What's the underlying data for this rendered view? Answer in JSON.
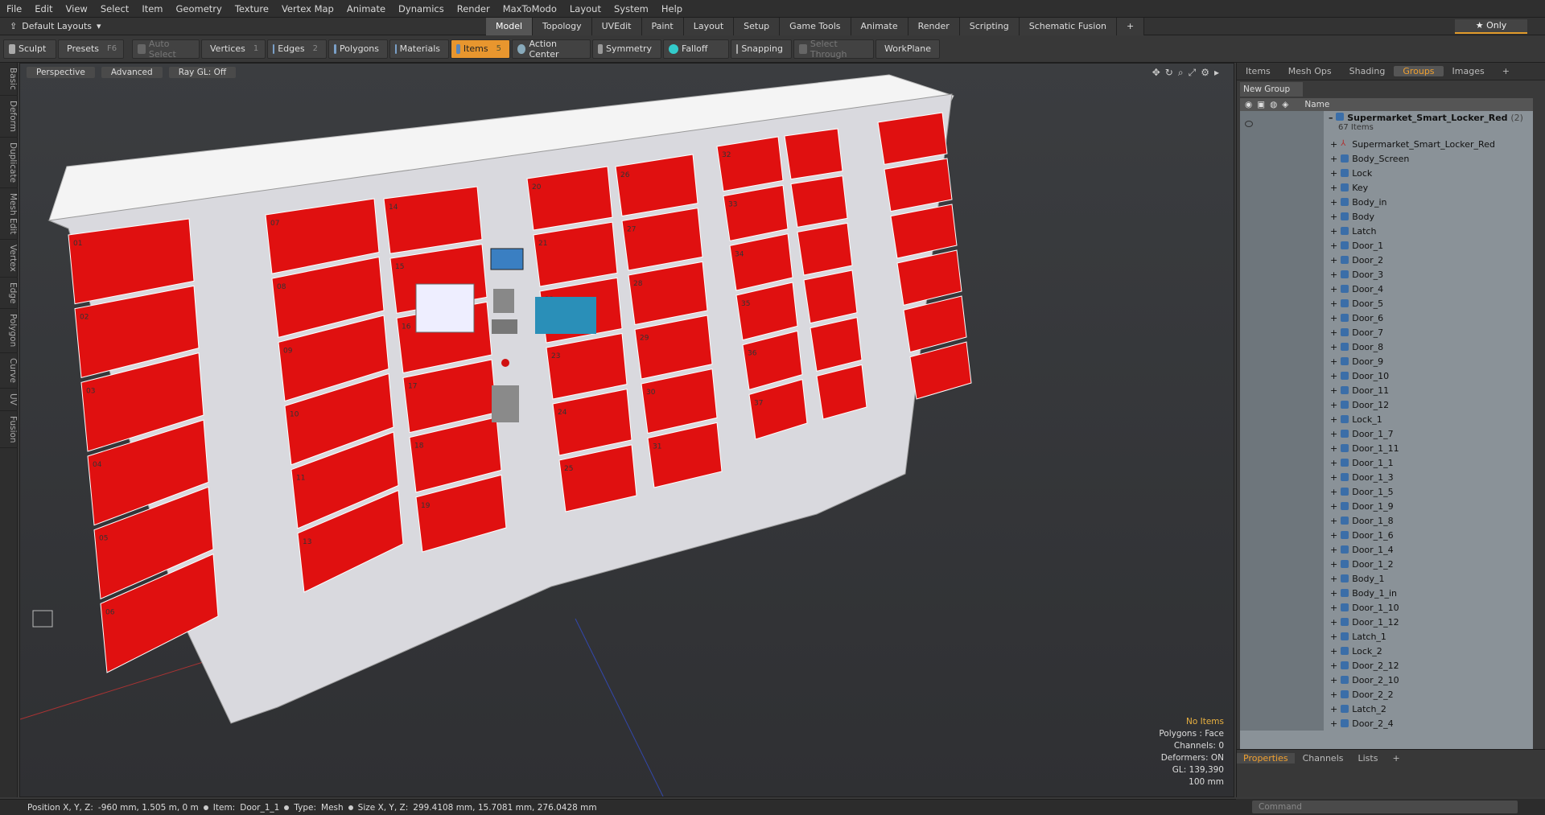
{
  "menu": [
    "File",
    "Edit",
    "View",
    "Select",
    "Item",
    "Geometry",
    "Texture",
    "Vertex Map",
    "Animate",
    "Dynamics",
    "Render",
    "MaxToModo",
    "Layout",
    "System",
    "Help"
  ],
  "layout_selector": "Default Layouts",
  "layout_tabs": [
    {
      "label": "Model",
      "active": true
    },
    {
      "label": "Topology"
    },
    {
      "label": "UVEdit"
    },
    {
      "label": "Paint"
    },
    {
      "label": "Layout"
    },
    {
      "label": "Setup"
    },
    {
      "label": "Game Tools"
    },
    {
      "label": "Animate"
    },
    {
      "label": "Render"
    },
    {
      "label": "Scripting"
    },
    {
      "label": "Schematic Fusion"
    },
    {
      "label": "+"
    }
  ],
  "only_label": "Only",
  "toolbar": {
    "sculpt": "Sculpt",
    "presets": "Presets",
    "presets_key": "F6",
    "auto_select": "Auto Select",
    "vertices": "Vertices",
    "vertices_key": "1",
    "edges": "Edges",
    "edges_key": "2",
    "polygons": "Polygons",
    "materials": "Materials",
    "items": "Items",
    "items_key": "5",
    "action_center": "Action Center",
    "symmetry": "Symmetry",
    "falloff": "Falloff",
    "snapping": "Snapping",
    "select_through": "Select Through",
    "workplane": "WorkPlane"
  },
  "left_tabs": [
    "Basic",
    "Deform",
    "Duplicate",
    "Mesh Edit",
    "Vertex",
    "Edge",
    "Polygon",
    "Curve",
    "UV",
    "Fusion"
  ],
  "viewport": {
    "view": "Perspective",
    "shading": "Advanced",
    "raygl": "Ray GL: Off",
    "stats": {
      "selection": "No Items",
      "polygons": "Polygons : Face",
      "channels": "Channels: 0",
      "deformers": "Deformers: ON",
      "gl": "GL: 139,390",
      "scale": "100 mm"
    },
    "door_numbers": [
      "01",
      "02",
      "03",
      "04",
      "05",
      "06",
      "07",
      "08",
      "09",
      "10",
      "11",
      "13",
      "14",
      "15",
      "16",
      "17",
      "18",
      "19",
      "20",
      "21",
      "22",
      "23",
      "24",
      "25",
      "26",
      "27",
      "28",
      "29",
      "30",
      "31",
      "32",
      "33",
      "34",
      "35",
      "36",
      "37"
    ]
  },
  "right_panel": {
    "tabs": [
      {
        "label": "Items"
      },
      {
        "label": "Mesh Ops"
      },
      {
        "label": "Shading"
      },
      {
        "label": "Groups",
        "active": true
      },
      {
        "label": "Images"
      },
      {
        "label": "+"
      }
    ],
    "new_group": "New Group",
    "name_header": "Name",
    "group": {
      "name": "Supermarket_Smart_Locker_Red",
      "count": "(2)",
      "items": "67 Items"
    },
    "items": [
      {
        "name": "Supermarket_Smart_Locker_Red",
        "icon": "locator-icon"
      },
      {
        "name": "Body_Screen"
      },
      {
        "name": "Lock"
      },
      {
        "name": "Key"
      },
      {
        "name": "Body_in"
      },
      {
        "name": "Body"
      },
      {
        "name": "Latch"
      },
      {
        "name": "Door_1"
      },
      {
        "name": "Door_2"
      },
      {
        "name": "Door_3"
      },
      {
        "name": "Door_4"
      },
      {
        "name": "Door_5"
      },
      {
        "name": "Door_6"
      },
      {
        "name": "Door_7"
      },
      {
        "name": "Door_8"
      },
      {
        "name": "Door_9"
      },
      {
        "name": "Door_10"
      },
      {
        "name": "Door_11"
      },
      {
        "name": "Door_12"
      },
      {
        "name": "Lock_1"
      },
      {
        "name": "Door_1_7"
      },
      {
        "name": "Door_1_11"
      },
      {
        "name": "Door_1_1"
      },
      {
        "name": "Door_1_3"
      },
      {
        "name": "Door_1_5"
      },
      {
        "name": "Door_1_9"
      },
      {
        "name": "Door_1_8"
      },
      {
        "name": "Door_1_6"
      },
      {
        "name": "Door_1_4"
      },
      {
        "name": "Door_1_2"
      },
      {
        "name": "Body_1"
      },
      {
        "name": "Body_1_in"
      },
      {
        "name": "Door_1_10"
      },
      {
        "name": "Door_1_12"
      },
      {
        "name": "Latch_1"
      },
      {
        "name": "Lock_2"
      },
      {
        "name": "Door_2_12"
      },
      {
        "name": "Door_2_10"
      },
      {
        "name": "Door_2_2"
      },
      {
        "name": "Latch_2"
      },
      {
        "name": "Door_2_4"
      }
    ]
  },
  "bottom_panel": {
    "tabs": [
      {
        "label": "Properties",
        "active": true
      },
      {
        "label": "Channels"
      },
      {
        "label": "Lists"
      },
      {
        "label": "+"
      }
    ]
  },
  "command_placeholder": "Command",
  "status": {
    "position_label": "Position X, Y, Z:",
    "position": "-960 mm, 1.505 m, 0 m",
    "item_label": "Item:",
    "item": "Door_1_1",
    "type_label": "Type:",
    "type": "Mesh",
    "size_label": "Size X, Y, Z:",
    "size": "299.4108 mm, 15.7081 mm, 276.0428 mm"
  }
}
